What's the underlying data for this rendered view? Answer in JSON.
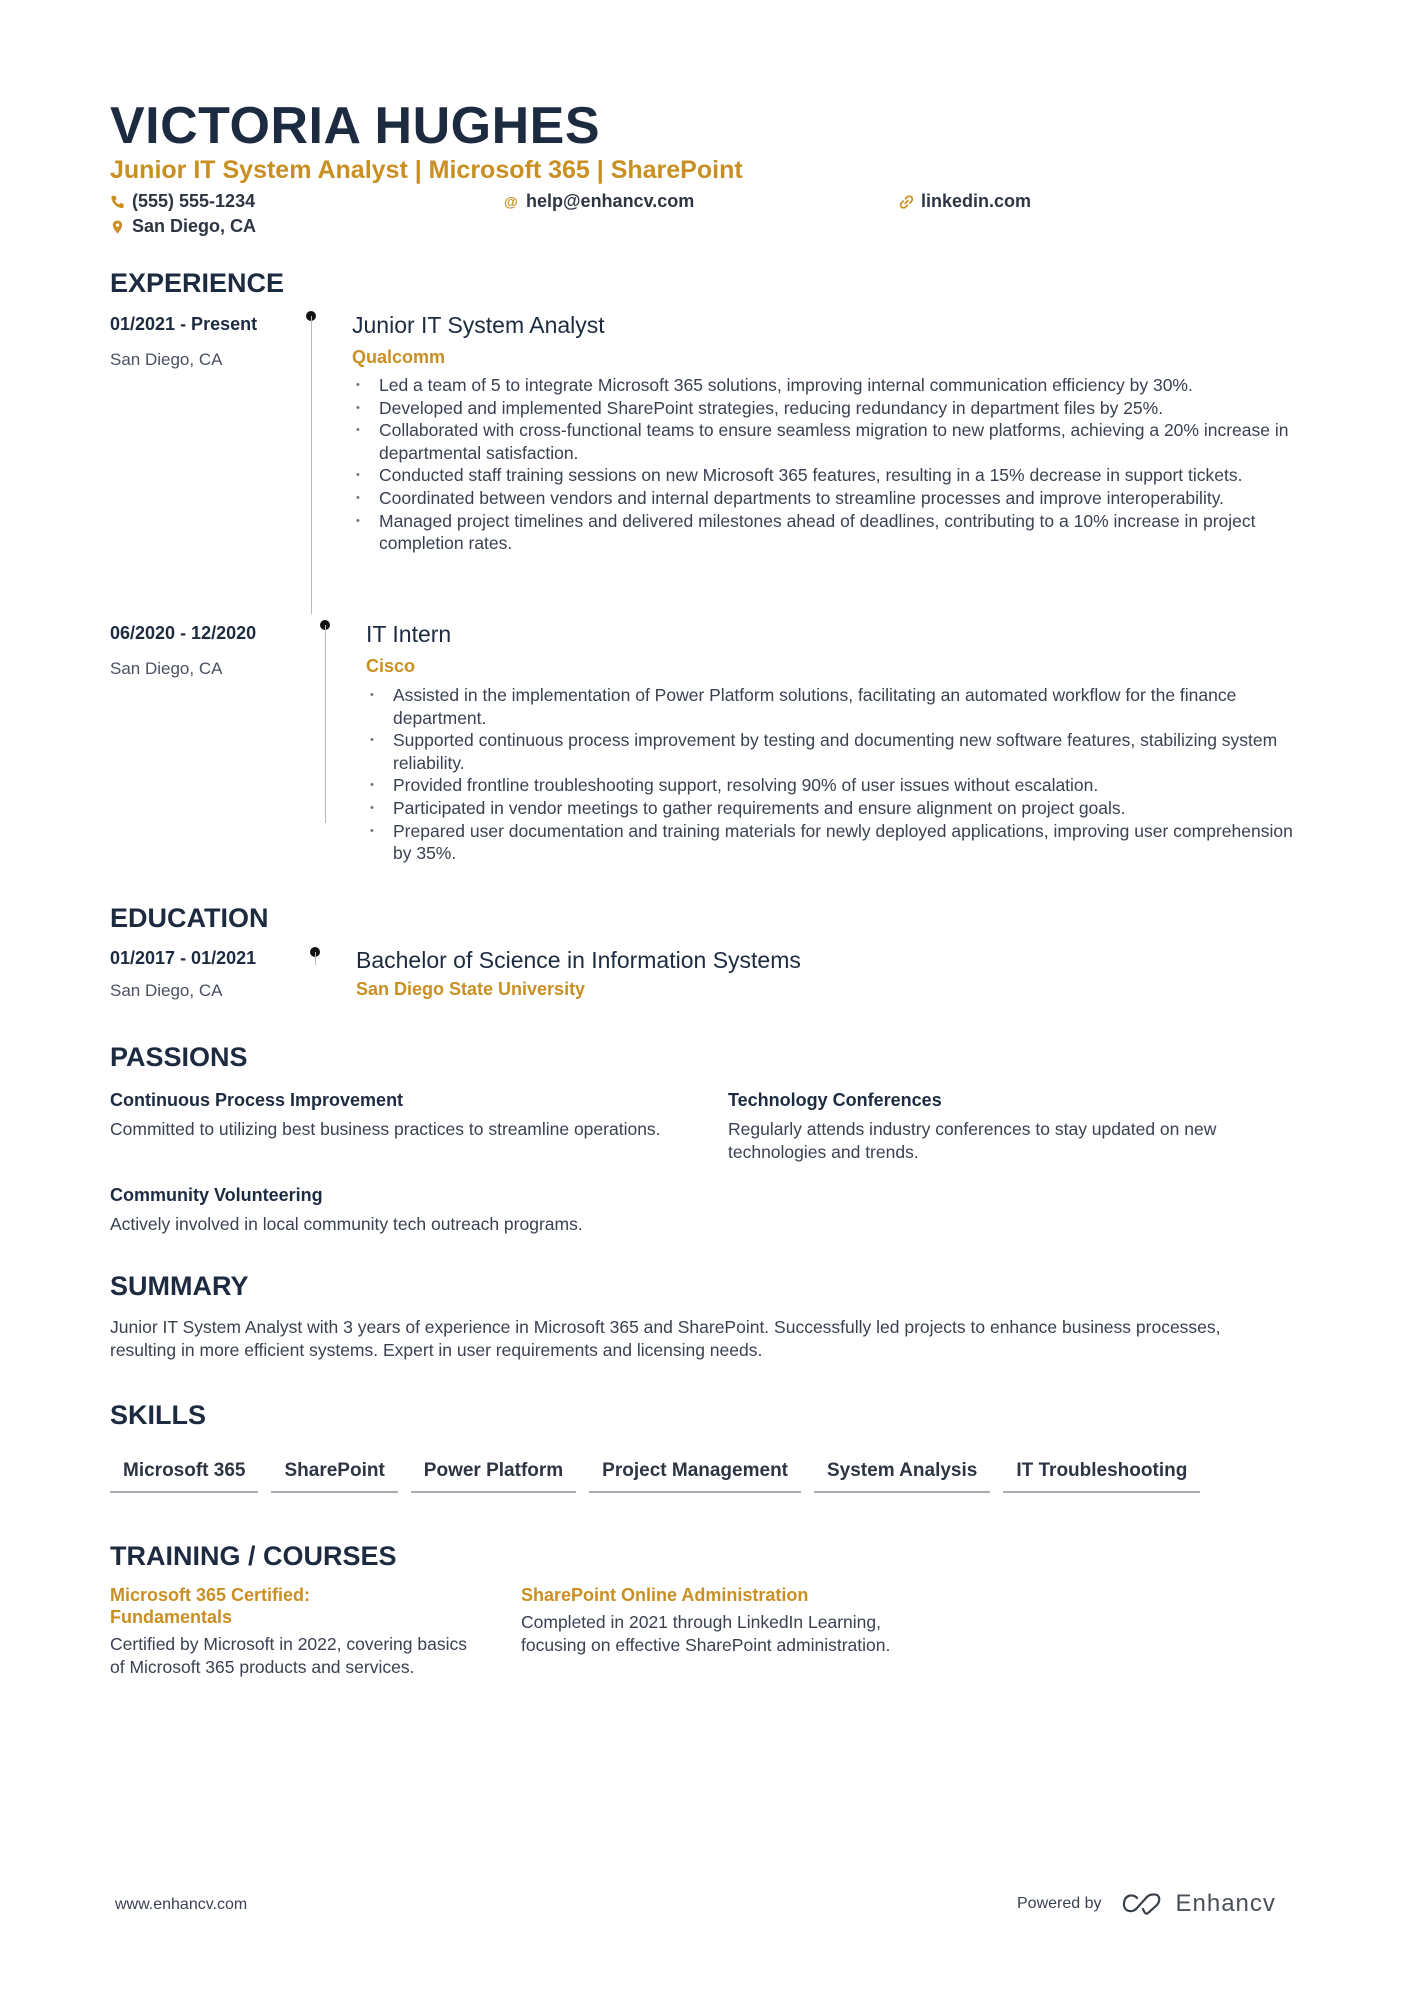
{
  "header": {
    "name": "VICTORIA HUGHES",
    "headline": "Junior IT System Analyst | Microsoft 365 | SharePoint",
    "phone": "(555) 555-1234",
    "email": "help@enhancv.com",
    "linkedin": "linkedin.com",
    "location": "San Diego, CA"
  },
  "experience": {
    "title": "EXPERIENCE",
    "items": [
      {
        "dates": "01/2021 - Present",
        "location": "San Diego, CA",
        "role": "Junior IT System Analyst",
        "company": "Qualcomm",
        "bullets": [
          "Led a team of 5 to integrate Microsoft 365 solutions, improving internal communication efficiency by 30%.",
          "Developed and implemented SharePoint strategies, reducing redundancy in department files by 25%.",
          "Collaborated with cross-functional teams to ensure seamless migration to new platforms, achieving a 20% increase in departmental satisfaction.",
          "Conducted staff training sessions on new Microsoft 365 features, resulting in a 15% decrease in support tickets.",
          "Coordinated between vendors and internal departments to streamline processes and improve interoperability.",
          "Managed project timelines and delivered milestones ahead of deadlines, contributing to a 10% increase in project completion rates."
        ]
      },
      {
        "dates": "06/2020 - 12/2020",
        "location": "San Diego, CA",
        "role": "IT Intern",
        "company": "Cisco",
        "bullets": [
          "Assisted in the implementation of Power Platform solutions, facilitating an automated workflow for the finance department.",
          "Supported continuous process improvement by testing and documenting new software features, stabilizing system reliability.",
          "Provided frontline troubleshooting support, resolving 90% of user issues without escalation.",
          "Participated in vendor meetings to gather requirements and ensure alignment on project goals.",
          "Prepared user documentation and training materials for newly deployed applications, improving user comprehension by 35%."
        ]
      }
    ]
  },
  "education": {
    "title": "EDUCATION",
    "dates": "01/2017 - 01/2021",
    "location": "San Diego, CA",
    "degree": "Bachelor of Science in Information Systems",
    "school": "San Diego State University"
  },
  "passions": {
    "title": "PASSIONS",
    "items": [
      {
        "title": "Continuous Process Improvement",
        "text": "Committed to utilizing best business practices to streamline operations."
      },
      {
        "title": "Technology Conferences",
        "text": "Regularly attends industry conferences to stay updated on new technologies and trends."
      },
      {
        "title": "Community Volunteering",
        "text": "Actively involved in local community tech outreach programs."
      }
    ]
  },
  "summary": {
    "title": "SUMMARY",
    "text": "Junior IT System Analyst with 3 years of experience in Microsoft 365 and SharePoint. Successfully led projects to enhance business processes, resulting in more efficient systems. Expert in user requirements and licensing needs."
  },
  "skills": {
    "title": "SKILLS",
    "items": [
      "Microsoft 365",
      "SharePoint",
      "Power Platform",
      "Project Management",
      "System Analysis",
      "IT Troubleshooting"
    ]
  },
  "training": {
    "title": "TRAINING / COURSES",
    "items": [
      {
        "title": "Microsoft 365 Certified: Fundamentals",
        "text": "Certified by Microsoft in 2022, covering basics of Microsoft 365 products and services."
      },
      {
        "title": "SharePoint Online Administration",
        "text": "Completed in 2021 through LinkedIn Learning, focusing on effective SharePoint administration."
      }
    ]
  },
  "footer": {
    "website": "www.enhancv.com",
    "powered_by": "Powered by",
    "brand": "Enhancv"
  },
  "colors": {
    "accent": "#c98f22",
    "heading": "#1d2b41",
    "text": "#3a4150"
  }
}
